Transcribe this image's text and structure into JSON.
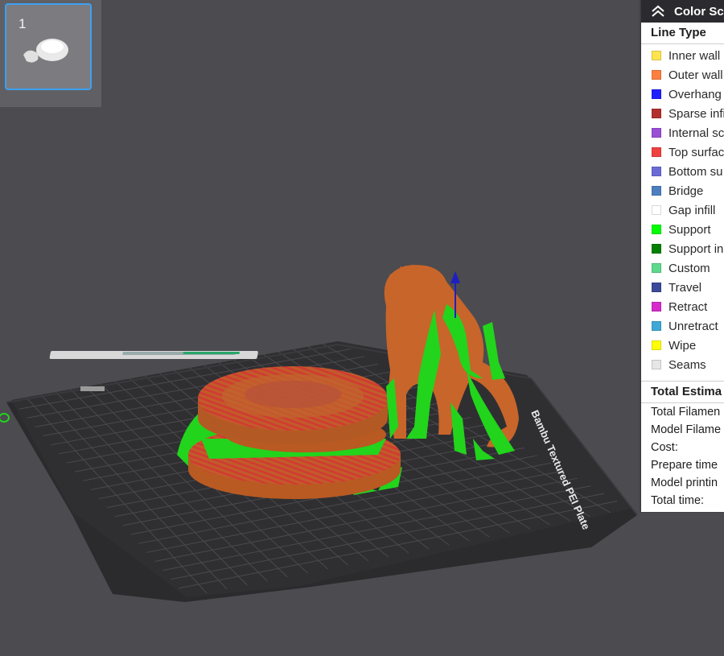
{
  "plate_list": {
    "items": [
      {
        "number": "1",
        "selected": true
      }
    ]
  },
  "bed": {
    "brand_label": "Bambu Textured PEI Plate"
  },
  "legend": {
    "header": "Color Sc",
    "section_title": "Line Type",
    "items": [
      {
        "label": "Inner wall",
        "color": "#FFE44D"
      },
      {
        "label": "Outer wall",
        "color": "#FF7F3F"
      },
      {
        "label": "Overhang",
        "color": "#1F1FFF"
      },
      {
        "label": "Sparse infi",
        "color": "#B22E2E"
      },
      {
        "label": "Internal sc",
        "color": "#9A4FD6"
      },
      {
        "label": "Top surfac",
        "color": "#F04040"
      },
      {
        "label": "Bottom su",
        "color": "#6B6BD6"
      },
      {
        "label": "Bridge",
        "color": "#4D7FBF"
      },
      {
        "label": "Gap infill",
        "color": "#FFFFFF"
      },
      {
        "label": "Support",
        "color": "#00FF00"
      },
      {
        "label": "Support in",
        "color": "#008000"
      },
      {
        "label": "Custom",
        "color": "#5ED98C"
      },
      {
        "label": "Travel",
        "color": "#3A4A99"
      },
      {
        "label": "Retract",
        "color": "#D62ACB"
      },
      {
        "label": "Unretract",
        "color": "#3FA8D6"
      },
      {
        "label": "Wipe",
        "color": "#FFFF00"
      },
      {
        "label": "Seams",
        "color": "#E6E6E6"
      }
    ]
  },
  "estimates": {
    "title": "Total Estima",
    "rows": [
      "Total Filamen",
      "Model Filame",
      "Cost:",
      "Prepare time",
      "Model printin",
      "Total time:"
    ]
  },
  "colors": {
    "background": "#4B4B50",
    "model_orange": "#C8652A",
    "support_green": "#22D41C",
    "selection_blue": "#3EA0F0"
  }
}
